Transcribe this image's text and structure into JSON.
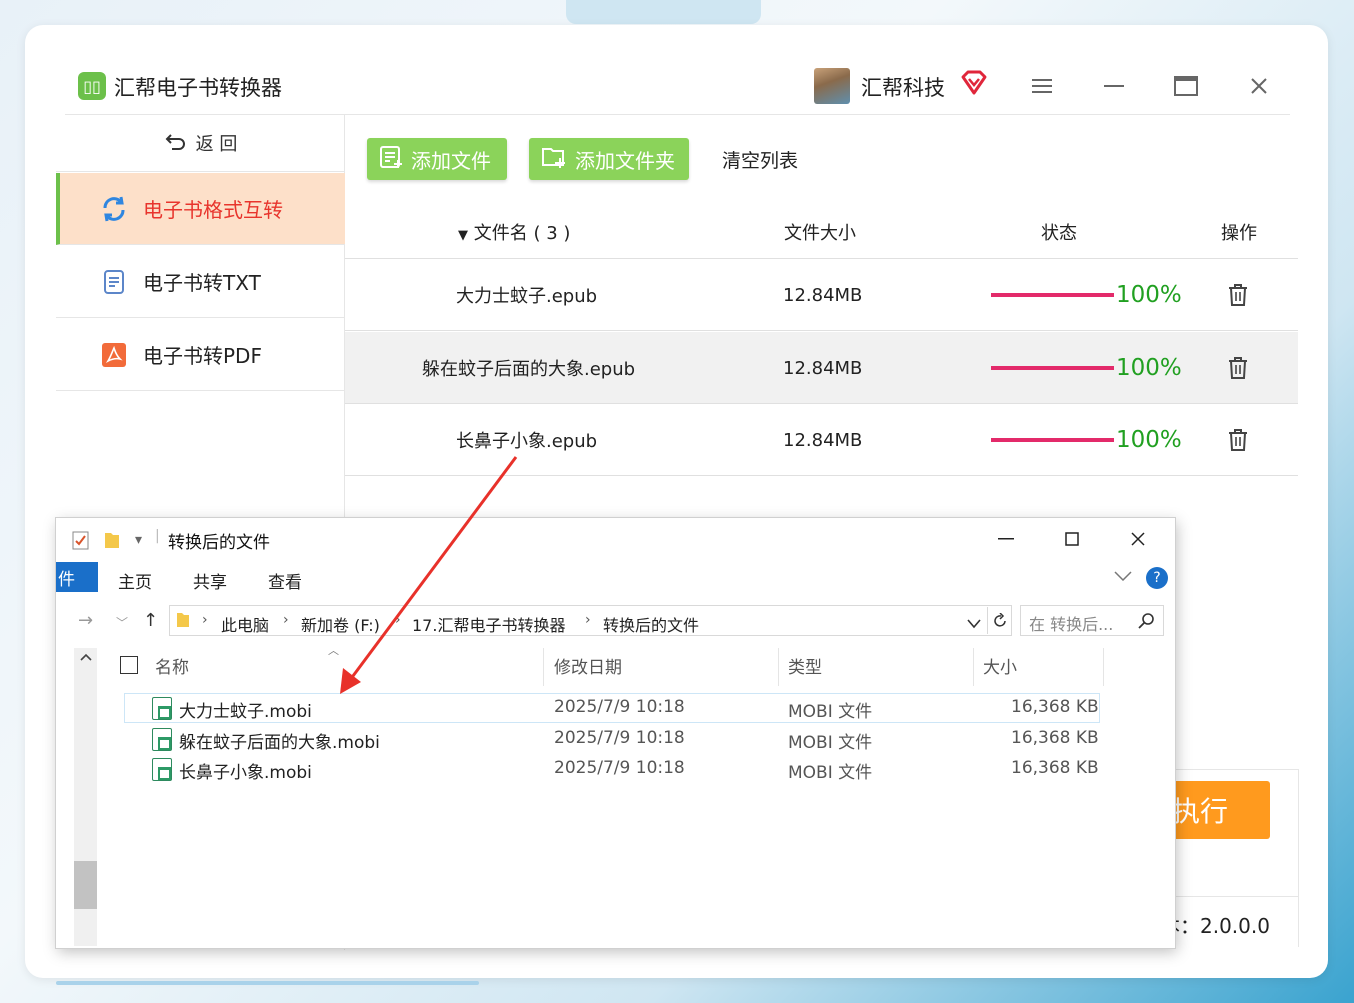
{
  "app": {
    "title": "汇帮电子书转换器",
    "user_name": "汇帮科技",
    "back_label": "返 回",
    "version_label": "本：2.0.0.0",
    "run_label": "执行"
  },
  "sidebar": {
    "items": [
      {
        "label": "电子书格式互转",
        "icon": "refresh-icon",
        "active": true
      },
      {
        "label": "电子书转TXT",
        "icon": "document-icon",
        "active": false
      },
      {
        "label": "电子书转PDF",
        "icon": "pdf-icon",
        "active": false
      }
    ]
  },
  "toolbar": {
    "add_file": "添加文件",
    "add_folder": "添加文件夹",
    "clear_list": "清空列表"
  },
  "table": {
    "headers": {
      "name": "文件名 ( 3 )",
      "size": "文件大小",
      "status": "状态",
      "action": "操作"
    },
    "rows": [
      {
        "name": "大力士蚊子.epub",
        "size": "12.84MB",
        "progress": 100,
        "progress_label": "100%"
      },
      {
        "name": "躲在蚊子后面的大象.epub",
        "size": "12.84MB",
        "progress": 100,
        "progress_label": "100%"
      },
      {
        "name": "长鼻子小象.epub",
        "size": "12.84MB",
        "progress": 100,
        "progress_label": "100%"
      }
    ]
  },
  "explorer": {
    "title": "转换后的文件",
    "ribbon": {
      "file": "件",
      "home": "主页",
      "share": "共享",
      "view": "查看"
    },
    "breadcrumb": [
      "此电脑",
      "新加卷 (F:)",
      "17.汇帮电子书转换器",
      "转换后的文件"
    ],
    "search_placeholder": "在 转换后...",
    "columns": {
      "name": "名称",
      "date": "修改日期",
      "type": "类型",
      "size": "大小"
    },
    "files": [
      {
        "name": "大力士蚊子.mobi",
        "date": "2025/7/9 10:18",
        "type": "MOBI 文件",
        "size": "16,368 KB"
      },
      {
        "name": "躲在蚊子后面的大象.mobi",
        "date": "2025/7/9 10:18",
        "type": "MOBI 文件",
        "size": "16,368 KB"
      },
      {
        "name": "长鼻子小象.mobi",
        "date": "2025/7/9 10:18",
        "type": "MOBI 文件",
        "size": "16,368 KB"
      }
    ]
  },
  "colors": {
    "accent_green": "#8bd35a",
    "active_bg": "#fde0c9",
    "active_text": "#e8342c",
    "progress_bar": "#e32a6a",
    "progress_text": "#21a021",
    "run_button": "#ff9a1e",
    "arrow": "#e8312a"
  }
}
